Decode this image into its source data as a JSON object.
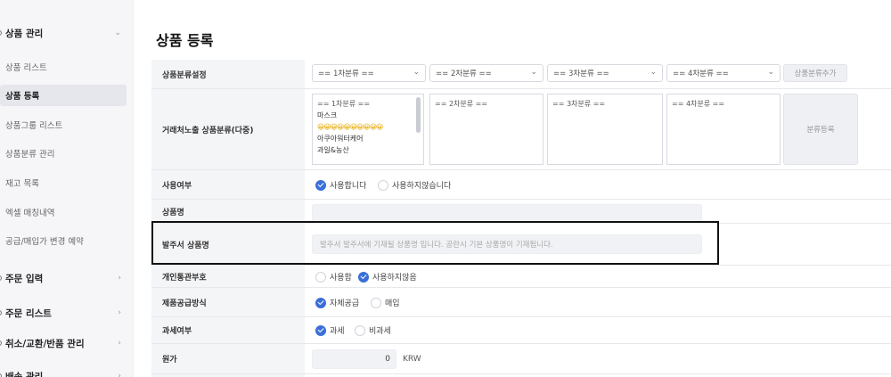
{
  "sidebar": {
    "product_section": "상품 관리",
    "product_items": [
      "상품 리스트",
      "상품 등록",
      "상품그룹 리스트",
      "상품분류 관리",
      "재고 목록",
      "엑셀 매칭내역",
      "공급/매입가 변경 예약"
    ],
    "other_sections": [
      "주문 입력",
      "주문 리스트",
      "취소/교환/반품 관리",
      "배송 관리"
    ]
  },
  "page": {
    "title": "상품 등록"
  },
  "form": {
    "category_label": "상품분류설정",
    "category_selects": [
      "== 1차분류 ==",
      "== 2차분류 ==",
      "== 3차분류 ==",
      "== 4차분류 =="
    ],
    "category_add_button": "상품분류추가",
    "exposure_label": "거래처노출 상품분류(다중)",
    "exposure_list1": [
      "== 1차분류 ==",
      "마스크",
      "😀😀😀😀😀😀😀😀😀😀",
      "아쿠아워터케어",
      "과일&농산"
    ],
    "exposure_list2": "== 2차분류 ==",
    "exposure_list3": "== 3차분류 ==",
    "exposure_list4": "== 4차분류 ==",
    "exposure_register_button": "분류등록",
    "use_label": "사용여부",
    "use_options": [
      "사용합니다",
      "사용하지않습니다"
    ],
    "name_label": "상품명",
    "order_name_label": "발주서 상품명",
    "order_name_placeholder": "발주서 발주서에 기재될 상품명 입니다. 공란시 기본 상품명이 기재됩니다.",
    "personal_label": "개인통관부호",
    "personal_options": [
      "사용함",
      "사용하지않음"
    ],
    "supply_label": "제품공급방식",
    "supply_options": [
      "자체공급",
      "매입"
    ],
    "tax_label": "과세여부",
    "tax_options": [
      "과세",
      "비과세"
    ],
    "cost_label": "원가",
    "cost_value": "0",
    "cost_unit": "KRW"
  }
}
